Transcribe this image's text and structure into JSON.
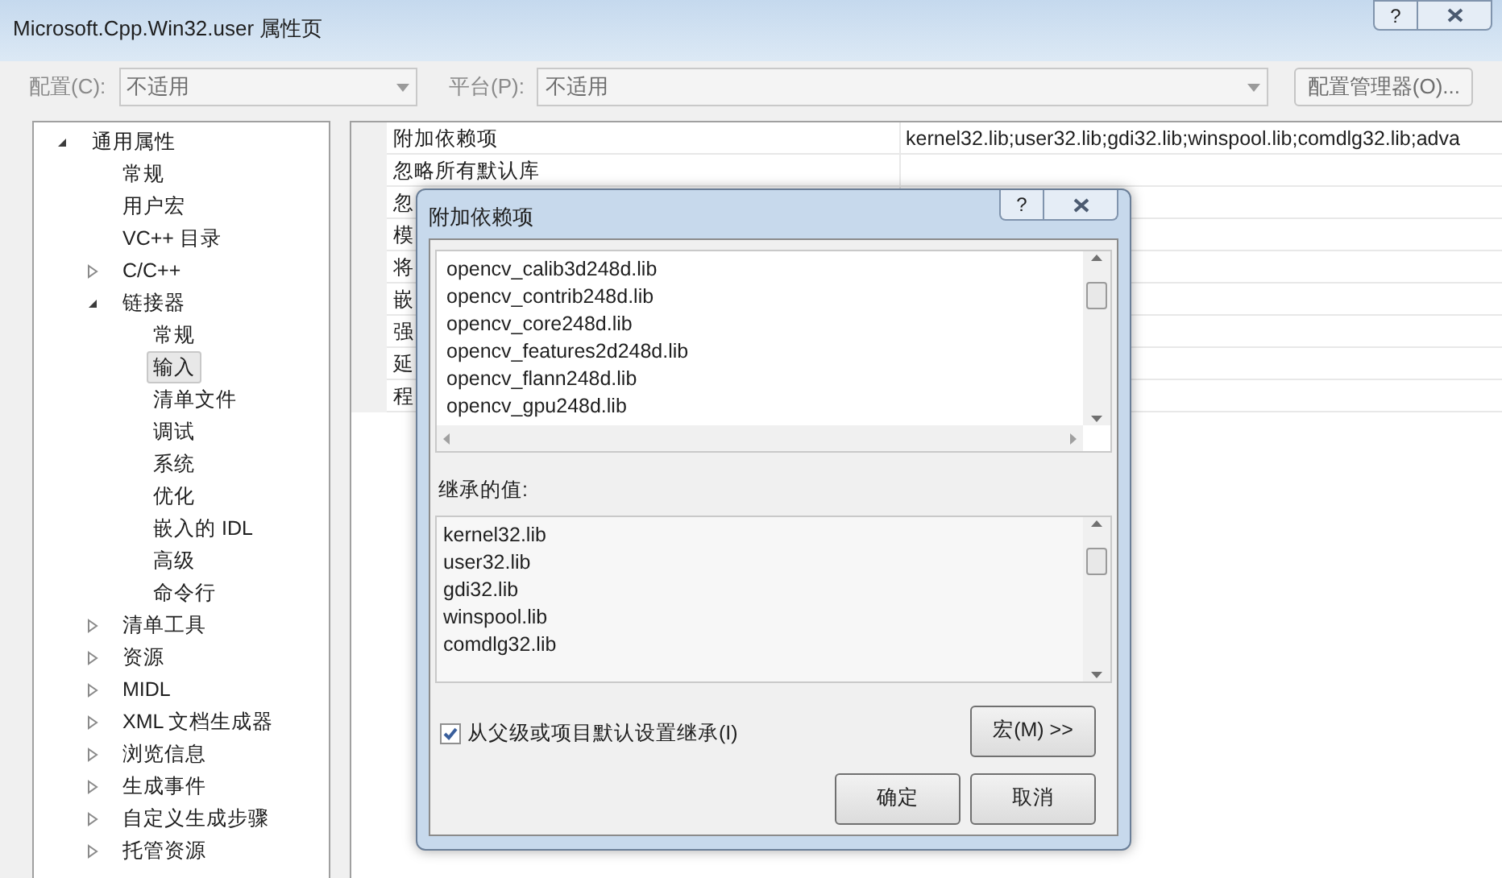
{
  "window": {
    "title": "Microsoft.Cpp.Win32.user 属性页",
    "help": "?"
  },
  "toolbar": {
    "config_label": "配置(C):",
    "config_value": "不适用",
    "platform_label": "平台(P):",
    "platform_value": "不适用",
    "manager_button": "配置管理器(O)..."
  },
  "tree": [
    {
      "label": "通用属性",
      "expanded": true,
      "selected": false,
      "children": [
        {
          "label": "常规",
          "selected": false
        },
        {
          "label": "用户宏",
          "selected": false
        },
        {
          "label": "VC++ 目录",
          "selected": false
        },
        {
          "label": "C/C++",
          "expanded": false,
          "selected": false
        },
        {
          "label": "链接器",
          "expanded": true,
          "selected": false,
          "children": [
            {
              "label": "常规",
              "selected": false
            },
            {
              "label": "输入",
              "selected": true
            },
            {
              "label": "清单文件",
              "selected": false
            },
            {
              "label": "调试",
              "selected": false
            },
            {
              "label": "系统",
              "selected": false
            },
            {
              "label": "优化",
              "selected": false
            },
            {
              "label": "嵌入的 IDL",
              "selected": false
            },
            {
              "label": "高级",
              "selected": false
            },
            {
              "label": "命令行",
              "selected": false
            }
          ]
        },
        {
          "label": "清单工具",
          "expanded": false,
          "selected": false
        },
        {
          "label": "资源",
          "expanded": false,
          "selected": false
        },
        {
          "label": "MIDL",
          "expanded": false,
          "selected": false
        },
        {
          "label": "XML 文档生成器",
          "expanded": false,
          "selected": false
        },
        {
          "label": "浏览信息",
          "expanded": false,
          "selected": false
        },
        {
          "label": "生成事件",
          "expanded": false,
          "selected": false
        },
        {
          "label": "自定义生成步骤",
          "expanded": false,
          "selected": false
        },
        {
          "label": "托管资源",
          "expanded": false,
          "selected": false
        }
      ]
    }
  ],
  "properties": [
    {
      "name": "附加依赖项",
      "value": "kernel32.lib;user32.lib;gdi32.lib;winspool.lib;comdlg32.lib;adva"
    },
    {
      "name": "忽略所有默认库"
    },
    {
      "name": "忽"
    },
    {
      "name": "模"
    },
    {
      "name": "将"
    },
    {
      "name": "嵌"
    },
    {
      "name": "强"
    },
    {
      "name": "延"
    },
    {
      "name": "程"
    }
  ],
  "dialog": {
    "title": "附加依赖项",
    "help": "?",
    "values": [
      "opencv_calib3d248d.lib",
      "opencv_contrib248d.lib",
      "opencv_core248d.lib",
      "opencv_features2d248d.lib",
      "opencv_flann248d.lib",
      "opencv_gpu248d.lib"
    ],
    "inherited_label": "继承的值:",
    "inherited": [
      "kernel32.lib",
      "user32.lib",
      "gdi32.lib",
      "winspool.lib",
      "comdlg32.lib"
    ],
    "inherit_checkbox": {
      "label": "从父级或项目默认设置继承(I)",
      "checked": true
    },
    "macro_button": "宏(M) >>",
    "ok_button": "确定",
    "cancel_button": "取消"
  }
}
